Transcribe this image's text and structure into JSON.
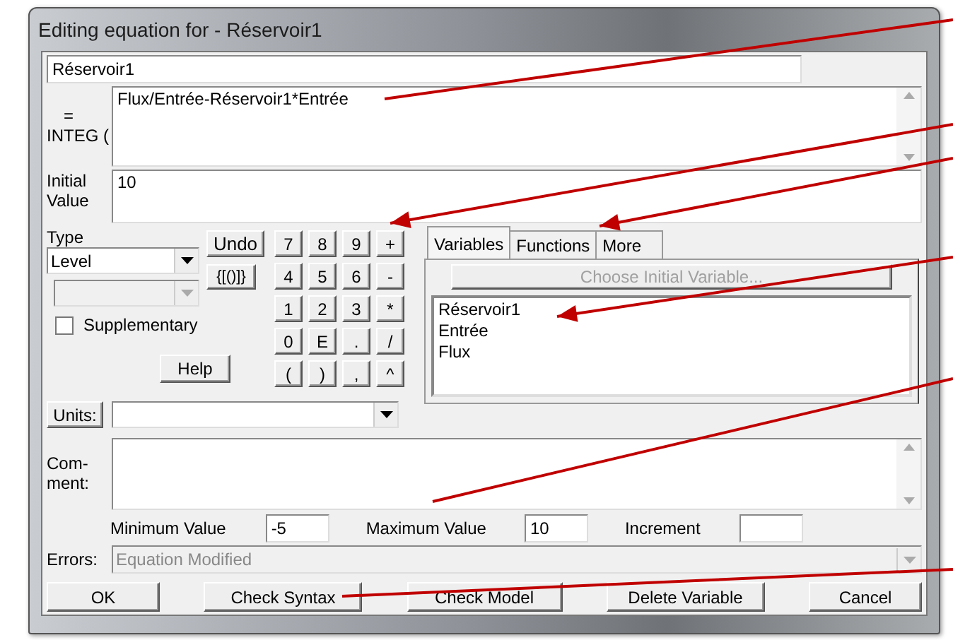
{
  "window": {
    "title": "Editing equation for - Réservoir1"
  },
  "variable_name": "Réservoir1",
  "equation": {
    "label_lines": [
      "=",
      "INTEG ("
    ],
    "value": "Flux/Entrée-Réservoir1*Entrée"
  },
  "initial_value": {
    "label_lines": [
      "Initial",
      "Value"
    ],
    "value": "10"
  },
  "type": {
    "label": "Type",
    "value": "Level"
  },
  "supplementary": {
    "label": "Supplementary",
    "checked": false
  },
  "undo": "Undo",
  "brackets": "{[()]}",
  "help": "Help",
  "keypad": [
    "7",
    "8",
    "9",
    "+",
    "4",
    "5",
    "6",
    "-",
    "1",
    "2",
    "3",
    "*",
    "0",
    "E",
    ".",
    "/",
    "(",
    ")",
    ",",
    "^"
  ],
  "tabs": [
    {
      "label": "Variables",
      "selected": true
    },
    {
      "label": "Functions",
      "selected": false
    },
    {
      "label": "More",
      "selected": false
    }
  ],
  "choose_button": {
    "label": "Choose Initial Variable...",
    "disabled": true
  },
  "variables": [
    "Réservoir1",
    "Entrée",
    "Flux"
  ],
  "units": {
    "label": "Units:"
  },
  "comment": {
    "label_lines": [
      "Com-",
      "ment:"
    ]
  },
  "range": [
    {
      "label": "Minimum Value",
      "value": "-5"
    },
    {
      "label": "Maximum Value",
      "value": "10"
    },
    {
      "label": "Increment"
    }
  ],
  "errors": {
    "label": "Errors:",
    "value": "Equation Modified"
  },
  "buttons": [
    "OK",
    "Check Syntax",
    "Check Model",
    "Delete Variable",
    "Cancel"
  ]
}
